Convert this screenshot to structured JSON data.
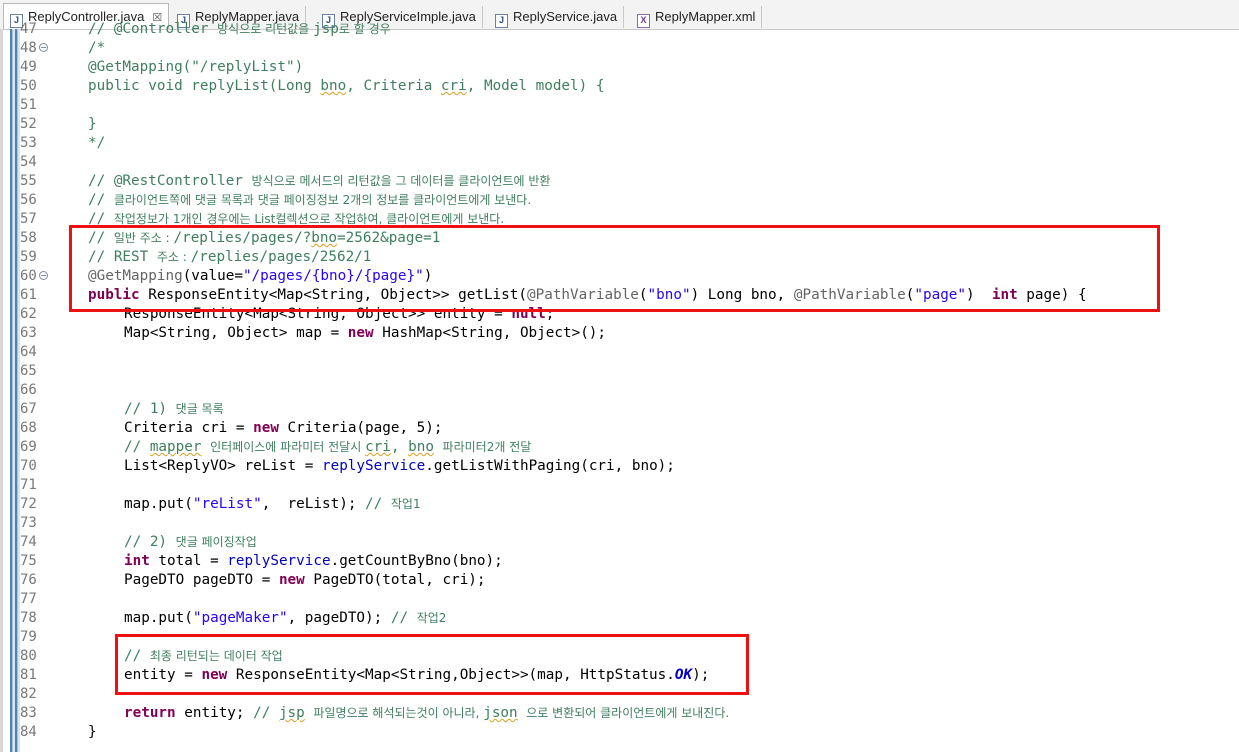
{
  "tabs": [
    {
      "label": "ReplyController.java",
      "icon": "java-file-icon",
      "active": true
    },
    {
      "label": "ReplyMapper.java",
      "icon": "java-file-icon"
    },
    {
      "label": "ReplyServiceImple.java",
      "icon": "java-file-icon"
    },
    {
      "label": "ReplyService.java",
      "icon": "java-file-icon"
    },
    {
      "label": "ReplyMapper.xml",
      "icon": "xml-file-icon"
    }
  ],
  "tab_close_glyph": "☒",
  "file_icon_letters": {
    "java": "J",
    "xml": "X"
  },
  "fold_glyph": "⊖",
  "lines": [
    {
      "n": "47",
      "indent": 0,
      "toks": [
        [
          "c",
          "// @Controller "
        ],
        [
          "ck",
          "방식으로 리턴값을 "
        ],
        [
          "c",
          "jsp"
        ],
        [
          "ck",
          "로 할 경우"
        ]
      ]
    },
    {
      "n": "48",
      "indent": 0,
      "fold": true,
      "toks": [
        [
          "c",
          "/*"
        ]
      ]
    },
    {
      "n": "49",
      "indent": 0,
      "toks": [
        [
          "c",
          "@GetMapping(\"/replyList\")"
        ]
      ]
    },
    {
      "n": "50",
      "indent": 0,
      "toks": [
        [
          "c",
          "public void replyList(Long "
        ],
        [
          "cu",
          "bno"
        ],
        [
          "c",
          ", Criteria "
        ],
        [
          "cu",
          "cri"
        ],
        [
          "c",
          ", Model model) {"
        ]
      ]
    },
    {
      "n": "51",
      "indent": 0,
      "toks": []
    },
    {
      "n": "52",
      "indent": 0,
      "toks": [
        [
          "c",
          "}"
        ]
      ]
    },
    {
      "n": "53",
      "indent": 0,
      "toks": [
        [
          "c",
          "*/"
        ]
      ]
    },
    {
      "n": "54",
      "indent": 0,
      "toks": []
    },
    {
      "n": "55",
      "indent": 0,
      "toks": [
        [
          "c",
          "// @RestController "
        ],
        [
          "ck",
          "방식으로 메서드의 리턴값을 그 데이터를 클라이언트에 반환"
        ]
      ]
    },
    {
      "n": "56",
      "indent": 0,
      "toks": [
        [
          "c",
          "// "
        ],
        [
          "ck",
          "클라이언트쪽에 댓글 목록과 댓글 페이징정보 2개의 정보를 클라이언트에게 보낸다."
        ]
      ]
    },
    {
      "n": "57",
      "indent": 0,
      "toks": [
        [
          "c",
          "// "
        ],
        [
          "ck",
          "작업정보가 1개인 경우에는 List컬렉션으로 작업하여, 클라이언트에게 보낸다."
        ]
      ]
    },
    {
      "n": "58",
      "indent": 0,
      "toks": [
        [
          "c",
          "// "
        ],
        [
          "ck",
          "일반 주소 : "
        ],
        [
          "c",
          "/replies/pages/?"
        ],
        [
          "cu",
          "bno"
        ],
        [
          "c",
          "=2562&page=1"
        ]
      ]
    },
    {
      "n": "59",
      "indent": 0,
      "toks": [
        [
          "c",
          "// REST "
        ],
        [
          "ck",
          "주소 : "
        ],
        [
          "c",
          "/replies/pages/2562/1"
        ]
      ]
    },
    {
      "n": "60",
      "indent": 0,
      "fold": true,
      "toks": [
        [
          "a",
          "@GetMapping"
        ],
        [
          "t",
          "(value="
        ],
        [
          "s",
          "\"/pages/{bno}/{page}\""
        ],
        [
          "t",
          ")"
        ]
      ]
    },
    {
      "n": "61",
      "indent": 0,
      "toks": [
        [
          "k",
          "public"
        ],
        [
          "t",
          " ResponseEntity<Map<String, Object>> getList("
        ],
        [
          "a",
          "@PathVariable"
        ],
        [
          "t",
          "("
        ],
        [
          "s",
          "\"bno\""
        ],
        [
          "t",
          ") Long bno, "
        ],
        [
          "a",
          "@PathVariable"
        ],
        [
          "t",
          "("
        ],
        [
          "s",
          "\"page\""
        ],
        [
          "t",
          ")  "
        ],
        [
          "k",
          "int"
        ],
        [
          "t",
          " page) {"
        ]
      ]
    },
    {
      "n": "62",
      "indent": 1,
      "toks": [
        [
          "t",
          "ResponseEntity<Map<String, Object>> entity = "
        ],
        [
          "k",
          "null"
        ],
        [
          "t",
          ";"
        ]
      ]
    },
    {
      "n": "63",
      "indent": 1,
      "toks": [
        [
          "t",
          "Map<String, Object> map = "
        ],
        [
          "k",
          "new"
        ],
        [
          "t",
          " HashMap<String, Object>();"
        ]
      ]
    },
    {
      "n": "64",
      "indent": 0,
      "toks": []
    },
    {
      "n": "65",
      "indent": 0,
      "toks": []
    },
    {
      "n": "66",
      "indent": 0,
      "toks": []
    },
    {
      "n": "67",
      "indent": 1,
      "toks": [
        [
          "c",
          "// 1) "
        ],
        [
          "ck",
          "댓글 목록"
        ]
      ]
    },
    {
      "n": "68",
      "indent": 1,
      "toks": [
        [
          "t",
          "Criteria cri = "
        ],
        [
          "k",
          "new"
        ],
        [
          "t",
          " Criteria(page, 5);"
        ]
      ]
    },
    {
      "n": "69",
      "indent": 1,
      "toks": [
        [
          "c",
          "// "
        ],
        [
          "cu",
          "mapper"
        ],
        [
          "c",
          " "
        ],
        [
          "ck",
          "인터페이스에 파라미터 전달시 "
        ],
        [
          "cu",
          "cri"
        ],
        [
          "c",
          ", "
        ],
        [
          "cu",
          "bno"
        ],
        [
          "c",
          " "
        ],
        [
          "ck",
          "파라미터2개 전달"
        ]
      ]
    },
    {
      "n": "70",
      "indent": 1,
      "toks": [
        [
          "t",
          "List<ReplyVO> reList = "
        ],
        [
          "f",
          "replyService"
        ],
        [
          "t",
          ".getListWithPaging(cri, bno);"
        ]
      ]
    },
    {
      "n": "71",
      "indent": 0,
      "toks": []
    },
    {
      "n": "72",
      "indent": 1,
      "toks": [
        [
          "t",
          "map.put("
        ],
        [
          "s",
          "\"reList\""
        ],
        [
          "t",
          ",  reList); "
        ],
        [
          "c",
          "// "
        ],
        [
          "ck",
          "작업1"
        ]
      ]
    },
    {
      "n": "73",
      "indent": 0,
      "toks": []
    },
    {
      "n": "74",
      "indent": 1,
      "toks": [
        [
          "c",
          "// 2) "
        ],
        [
          "ck",
          "댓글 페이징작업"
        ]
      ]
    },
    {
      "n": "75",
      "indent": 1,
      "toks": [
        [
          "k",
          "int"
        ],
        [
          "t",
          " total = "
        ],
        [
          "f",
          "replyService"
        ],
        [
          "t",
          ".getCountByBno(bno);"
        ]
      ]
    },
    {
      "n": "76",
      "indent": 1,
      "toks": [
        [
          "t",
          "PageDTO pageDTO = "
        ],
        [
          "k",
          "new"
        ],
        [
          "t",
          " PageDTO(total, cri);"
        ]
      ]
    },
    {
      "n": "77",
      "indent": 0,
      "toks": []
    },
    {
      "n": "78",
      "indent": 1,
      "toks": [
        [
          "t",
          "map.put("
        ],
        [
          "s",
          "\"pageMaker\""
        ],
        [
          "t",
          ", pageDTO); "
        ],
        [
          "c",
          "// "
        ],
        [
          "ck",
          "작업2"
        ]
      ]
    },
    {
      "n": "79",
      "indent": 0,
      "toks": []
    },
    {
      "n": "80",
      "indent": 1,
      "toks": [
        [
          "c",
          "// "
        ],
        [
          "ck",
          "최종 리턴되는 데이터 작업"
        ]
      ]
    },
    {
      "n": "81",
      "indent": 1,
      "toks": [
        [
          "t",
          "entity = "
        ],
        [
          "k",
          "new"
        ],
        [
          "t",
          " ResponseEntity<Map<String,Object>>(map, HttpStatus."
        ],
        [
          "fi",
          "OK"
        ],
        [
          "t",
          ");"
        ]
      ]
    },
    {
      "n": "82",
      "indent": 0,
      "toks": []
    },
    {
      "n": "83",
      "indent": 1,
      "toks": [
        [
          "k",
          "return"
        ],
        [
          "t",
          " entity; "
        ],
        [
          "c",
          "// "
        ],
        [
          "cu",
          "jsp"
        ],
        [
          "c",
          " "
        ],
        [
          "ck",
          "파일명으로 해석되는것이 아니라, "
        ],
        [
          "cu",
          "json"
        ],
        [
          "c",
          " "
        ],
        [
          "ck",
          "으로 변환되어 클라이언트에게 보내진다."
        ]
      ]
    },
    {
      "n": "84",
      "indent": 0,
      "toks": [
        [
          "t",
          "}"
        ]
      ]
    }
  ],
  "highlight_color": "#ee1111"
}
